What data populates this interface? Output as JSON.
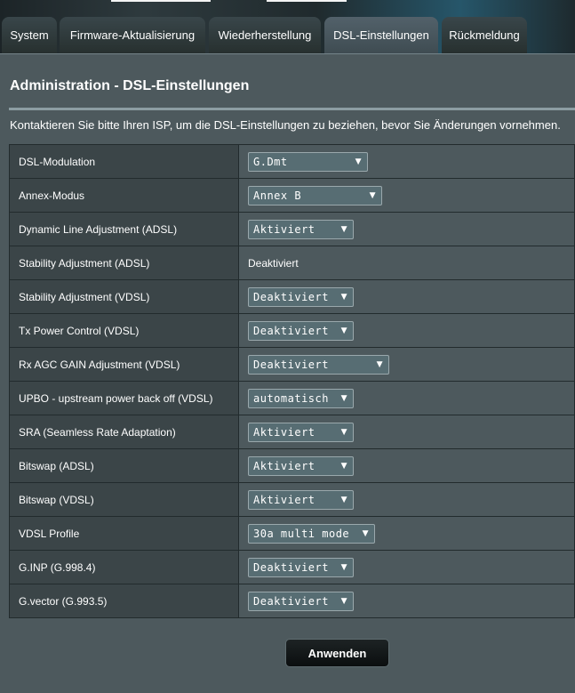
{
  "tabs": [
    {
      "label": "System",
      "active": false
    },
    {
      "label": "Firmware-Aktualisierung",
      "active": false
    },
    {
      "label": "Wiederherstellung",
      "active": false
    },
    {
      "label": "DSL-Einstellungen",
      "active": true
    },
    {
      "label": "Rückmeldung",
      "active": false
    }
  ],
  "page": {
    "title": "Administration - DSL-Einstellungen",
    "description": "Kontaktieren Sie bitte Ihren ISP, um die DSL-Einstellungen zu beziehen, bevor Sie Änderungen vornehmen."
  },
  "settings": [
    {
      "label": "DSL-Modulation",
      "value": "G.Dmt"
    },
    {
      "label": "Annex-Modus",
      "value": "Annex B"
    },
    {
      "label": "Dynamic Line Adjustment (ADSL)",
      "value": "Aktiviert"
    },
    {
      "label": "Stability Adjustment (ADSL)",
      "value": "Deaktiviert"
    },
    {
      "label": "Stability Adjustment (VDSL)",
      "value": "Deaktiviert"
    },
    {
      "label": "Tx Power Control (VDSL)",
      "value": "Deaktiviert"
    },
    {
      "label": "Rx AGC GAIN Adjustment (VDSL)",
      "value": "Deaktiviert"
    },
    {
      "label": "UPBO - upstream power back off (VDSL)",
      "value": "automatisch"
    },
    {
      "label": "SRA (Seamless Rate Adaptation)",
      "value": "Aktiviert"
    },
    {
      "label": "Bitswap (ADSL)",
      "value": "Aktiviert"
    },
    {
      "label": "Bitswap (VDSL)",
      "value": "Aktiviert"
    },
    {
      "label": "VDSL Profile",
      "value": "30a multi mode"
    },
    {
      "label": "G.INP (G.998.4)",
      "value": "Deaktiviert"
    },
    {
      "label": "G.vector (G.993.5)",
      "value": "Deaktiviert"
    }
  ],
  "actions": {
    "apply_label": "Anwenden"
  },
  "colors": {
    "background": "#4d595d",
    "label_cell": "#3b4548",
    "select_bg": "#576d73"
  }
}
